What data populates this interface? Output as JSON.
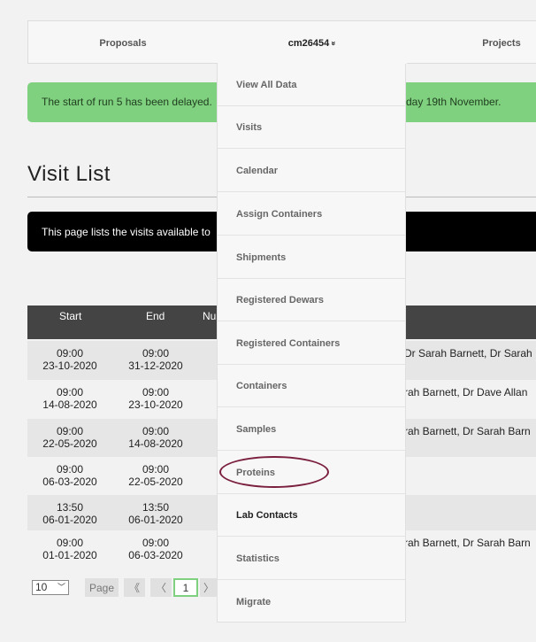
{
  "nav": {
    "proposals": "Proposals",
    "user": "cm26454",
    "user_chevron": "»",
    "projects": "Projects"
  },
  "alert": {
    "left_text": "The start of run 5 has been delayed.",
    "right_text": "day 19th November."
  },
  "page": {
    "title": "Visit List",
    "intro": "This page lists the visits available to"
  },
  "table": {
    "headers": [
      "Start",
      "End",
      "Nu"
    ],
    "rows": [
      {
        "start_time": "09:00",
        "start_date": "23-10-2020",
        "end_time": "09:00",
        "end_date": "31-12-2020",
        "users": "Dr Sarah Barnett, Dr Sarah"
      },
      {
        "start_time": "09:00",
        "start_date": "14-08-2020",
        "end_time": "09:00",
        "end_date": "23-10-2020",
        "users": "rah Barnett, Dr Dave Allan"
      },
      {
        "start_time": "09:00",
        "start_date": "22-05-2020",
        "end_time": "09:00",
        "end_date": "14-08-2020",
        "users": "rah Barnett, Dr Sarah Barn"
      },
      {
        "start_time": "09:00",
        "start_date": "06-03-2020",
        "end_time": "09:00",
        "end_date": "22-05-2020",
        "users": ""
      },
      {
        "start_time": "13:50",
        "start_date": "06-01-2020",
        "end_time": "13:50",
        "end_date": "06-01-2020",
        "users": ""
      },
      {
        "start_time": "09:00",
        "start_date": "01-01-2020",
        "end_time": "09:00",
        "end_date": "06-03-2020",
        "users": "rah Barnett, Dr Sarah Barn"
      }
    ]
  },
  "pager": {
    "per_page": "10",
    "page_label": "Page",
    "first": "《",
    "prev": "〈",
    "current": "1",
    "next": "〉"
  },
  "dropdown": {
    "items": [
      "View All Data",
      "Visits",
      "Calendar",
      "Assign Containers",
      "Shipments",
      "Registered Dewars",
      "Registered Containers",
      "Containers",
      "Samples",
      "Proteins",
      "Lab Contacts",
      "Statistics",
      "Migrate"
    ],
    "highlighted": "Proteins",
    "active": "Lab Contacts"
  },
  "colors": {
    "alert_bg": "#7fd17f",
    "highlight_ring": "#7a1f3d",
    "table_header_bg": "#444444"
  }
}
